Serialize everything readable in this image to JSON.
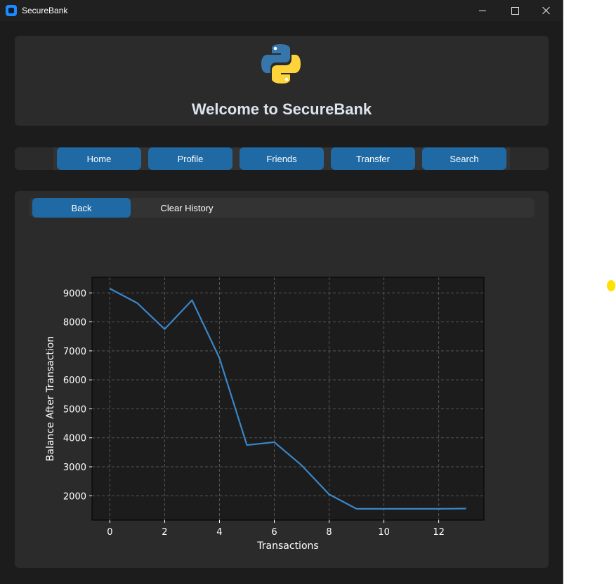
{
  "window": {
    "title": "SecureBank"
  },
  "header": {
    "welcome": "Welcome to SecureBank",
    "logo_icon": "python-logo-icon"
  },
  "nav": {
    "items": [
      "Home",
      "Profile",
      "Friends",
      "Transfer",
      "Search"
    ]
  },
  "toolbar": {
    "back_label": "Back",
    "clear_label": "Clear History"
  },
  "colors": {
    "accent": "#1f6aa5",
    "line": "#3a86c8",
    "background": "#1c1c1c",
    "panel": "#2b2b2b"
  },
  "chart_data": {
    "type": "line",
    "xlabel": "Transactions",
    "ylabel": "Balance After Transaction",
    "x": [
      0,
      1,
      2,
      3,
      4,
      5,
      6,
      7,
      8,
      9,
      10,
      11,
      12,
      13
    ],
    "series": [
      {
        "values": [
          9150,
          8650,
          7750,
          8750,
          6750,
          3750,
          3850,
          3050,
          2050,
          1550,
          1550,
          1550,
          1550,
          1560
        ]
      }
    ],
    "xticks": [
      0,
      2,
      4,
      6,
      8,
      10,
      12
    ],
    "yticks": [
      2000,
      3000,
      4000,
      5000,
      6000,
      7000,
      8000,
      9000
    ],
    "xlim": [
      -0.65,
      13.65
    ],
    "ylim": [
      1160,
      9540
    ],
    "grid": true
  }
}
